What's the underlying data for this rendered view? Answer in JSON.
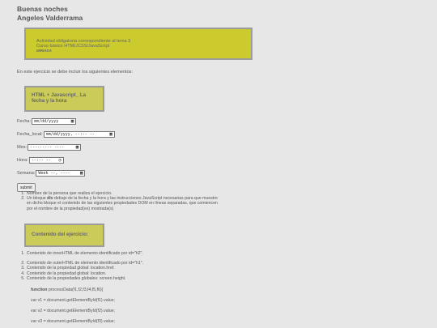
{
  "header": {
    "greeting": "Buenas noches",
    "name": "Angeles Valderrama"
  },
  "banner": {
    "line1": "Actividad obligatoria correspondiente al tema 3",
    "line2": "Curso básico HTML/CSS/JavaScript",
    "line3": "MIRIADA"
  },
  "intro": "En este ejercicio se debe incluir los siguientes elementos:",
  "box1": {
    "line1": "HTML + Javascript_ La",
    "line2": "fecha y la hora"
  },
  "form": {
    "date": {
      "label": "Fecha:",
      "placeholder": "mm/dd/yyyy"
    },
    "datetime": {
      "label": "Fecha_local:",
      "placeholder": "mm/dd/yyyy, --:-- --"
    },
    "month": {
      "label": "Mes:",
      "placeholder": "--------- ----"
    },
    "time": {
      "label": "Hora:",
      "placeholder": "--:-- --"
    },
    "week": {
      "label": "Semana:",
      "placeholder": "Week --, ----"
    },
    "submit_label": "submit"
  },
  "list1": {
    "item1": "Nombre de la persona que realiza el ejercicio.",
    "item2_pre": "Un bloque ",
    "item2_bold": "div",
    "item2_post": " debajo de la fecha y la hora y las instrucciones JavaScript necesarias para que muestre en dicho bloque el contenido de las siguientes propiedades DOM en líneas separadas, que comiencen por el nombre de la propiedad(es) mostrada(s)"
  },
  "box2": {
    "title": "Contenido del ejercicio:"
  },
  "list2": [
    "Contenido de innerHTML de elemento identificado por id=\"h2\".",
    "Contenido de outerHTML de elemento identificado por id=\"h1\".",
    "Contenido de la propiedad global: location.href.",
    "Contenido de la propiedad global: location.",
    "Contenido de la propiedades globales: screen.height."
  ],
  "code": {
    "keyword": "function",
    "line1_rest": " processData(f1,f2,f3,f4,f5,f6){",
    "line2": "var v1 = document.getElementById(f1).value;",
    "line3": "var v2 = document.getElementById(f2).value;",
    "line4": "var v3 = document.getElementById(f3).value;"
  }
}
